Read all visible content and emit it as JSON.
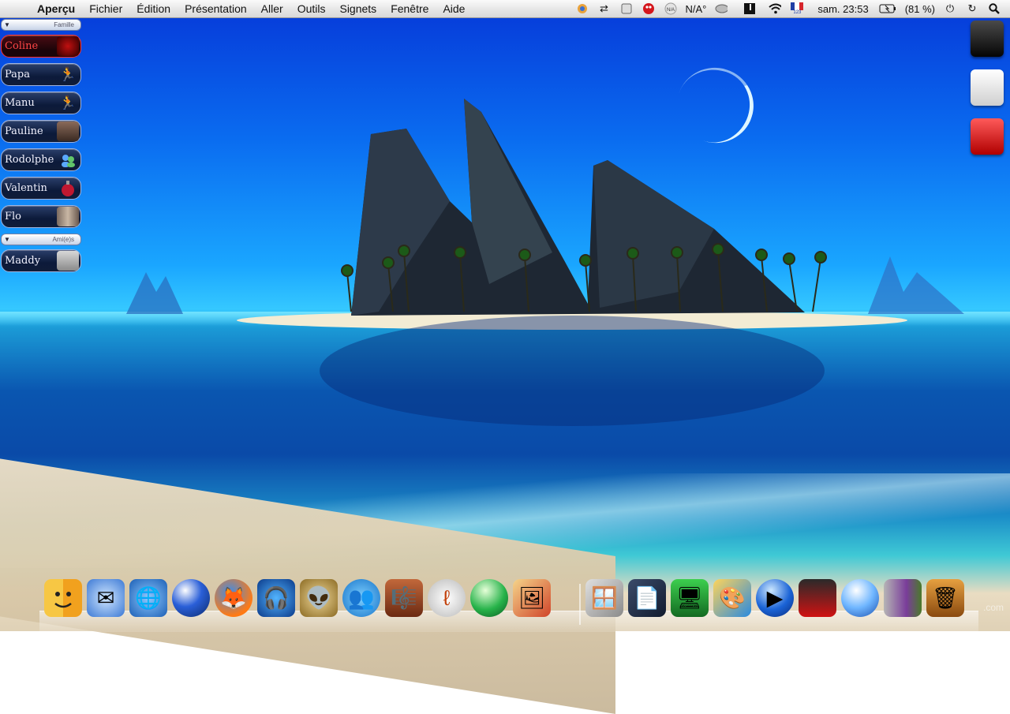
{
  "menubar": {
    "apple_symbol": "",
    "app_name": "Aperçu",
    "menus": [
      "Fichier",
      "Édition",
      "Présentation",
      "Aller",
      "Outils",
      "Signets",
      "Fenêtre",
      "Aide"
    ],
    "weather": "N/A°",
    "weather_badge": "N/A",
    "keyboard_layout_code": "123",
    "clock": "sam. 23:53",
    "battery": "(81 %)"
  },
  "buddies": {
    "groups": [
      {
        "name": "Famille",
        "members": [
          {
            "name": "Coline",
            "active": true
          },
          {
            "name": "Papa"
          },
          {
            "name": "Manu"
          },
          {
            "name": "Pauline"
          },
          {
            "name": "Rodolphe"
          },
          {
            "name": "Valentin"
          },
          {
            "name": "Flo"
          }
        ]
      },
      {
        "name": "Ami(e)s",
        "members": [
          {
            "name": "Maddy"
          }
        ]
      }
    ]
  },
  "dock": {
    "items": [
      "finder-icon",
      "mail-icon",
      "network-icon",
      "sphere-icon",
      "firefox-icon",
      "music-headphones-icon",
      "adium-icon",
      "messenger-icon",
      "itunes-icon",
      "dreamweaver-icon",
      "green-orb-icon",
      "photo-icon",
      "office-icon",
      "document-icon",
      "network-monitor-icon",
      "paint-icon",
      "quicktime-icon",
      "red-gadget-icon",
      "safari-orb-icon",
      "archive-icon",
      "trash-icon"
    ]
  },
  "watermark": ".com",
  "colors": {
    "accent": "#1aa6ff",
    "active_buddy": "#ff4545"
  }
}
